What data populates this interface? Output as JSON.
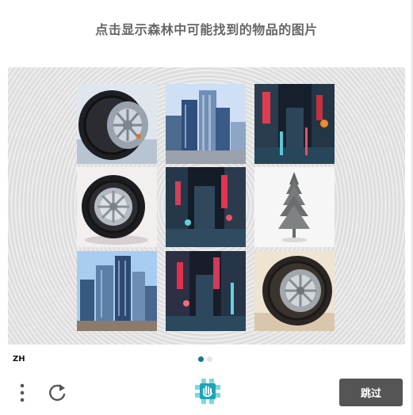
{
  "prompt": "点击显示森林中可能找到的物品的图片",
  "language_code": "ZH",
  "skip_label": "跳过",
  "tiles": [
    {
      "content": "tire"
    },
    {
      "content": "city-skyscrapers"
    },
    {
      "content": "neon-street"
    },
    {
      "content": "tire"
    },
    {
      "content": "neon-street"
    },
    {
      "content": "pine-tree"
    },
    {
      "content": "city-skyscrapers"
    },
    {
      "content": "neon-street"
    },
    {
      "content": "tire"
    }
  ],
  "pagination": {
    "current": 1,
    "total": 2
  },
  "colors": {
    "accent": "#147a85",
    "skip_button": "#555555",
    "title": "#666666"
  }
}
